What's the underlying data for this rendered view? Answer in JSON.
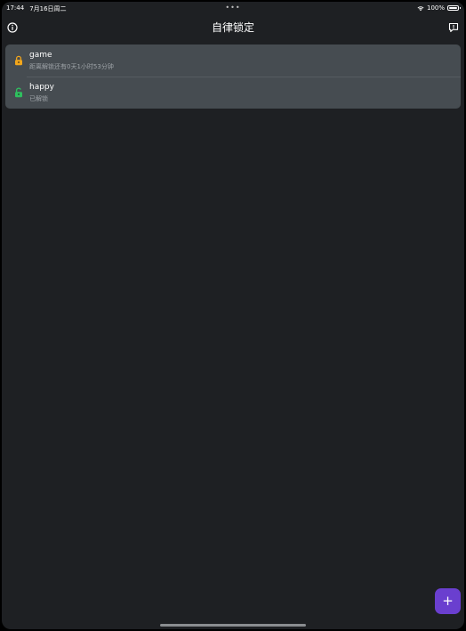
{
  "status_bar": {
    "time": "17:44",
    "date": "7月16日周二",
    "center_dots": "•••",
    "battery_percent": "100%",
    "wifi_icon": "wifi-icon",
    "battery_icon": "battery-icon"
  },
  "nav": {
    "title": "自律锁定",
    "left_icon": "info-icon",
    "right_icon": "feedback-icon"
  },
  "locks": [
    {
      "name": "game",
      "status": "距离解锁还有0天1小时53分钟",
      "icon": "lock-closed-icon",
      "icon_color": "#f2a61c"
    },
    {
      "name": "happy",
      "status": "已解锁",
      "icon": "lock-open-icon",
      "icon_color": "#2fbf5f"
    }
  ],
  "add_button": {
    "label": "+",
    "color": "#6a3fcf"
  },
  "colors": {
    "background": "#1e2023",
    "list_background": "#464c51"
  }
}
